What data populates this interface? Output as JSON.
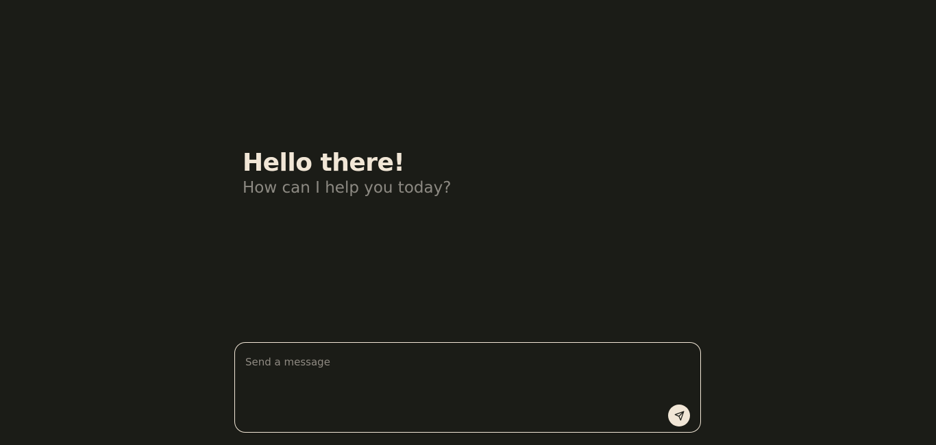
{
  "greeting": {
    "title": "Hello there!",
    "subtitle": "How can I help you today?"
  },
  "composer": {
    "placeholder": "Send a message",
    "value": "",
    "send_icon": "send-icon"
  },
  "colors": {
    "background": "#1b1c17",
    "title_text": "#f1e6d6",
    "subtitle_text": "#8c8982",
    "composer_border": "#f1e6d6",
    "send_button_bg": "#f1e6d6",
    "send_icon": "#1b1c17"
  }
}
